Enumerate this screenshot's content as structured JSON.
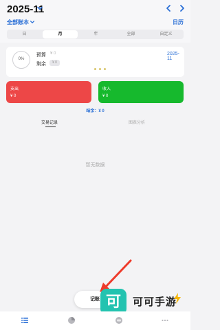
{
  "header": {
    "month": "2025-11",
    "all_books": "全部账本",
    "calendar": "日历"
  },
  "periods": [
    "日",
    "月",
    "年",
    "全部",
    "自定义"
  ],
  "selected_period": "月",
  "budget": {
    "progress": "0%",
    "budget_label": "预算",
    "budget_value": "¥ 0",
    "remaining_label": "剩余",
    "remaining_value": "¥ 0",
    "date": "2025-11"
  },
  "expense": {
    "label": "支出",
    "value": "¥ 0"
  },
  "income": {
    "label": "收入",
    "value": "¥ 0"
  },
  "balance": "结余：¥ 0",
  "tabs": {
    "records": "交易记录",
    "analysis": "图表分析"
  },
  "empty_text": "暂无数据",
  "fab_label": "记账",
  "watermark": {
    "logo_char": "可",
    "text": "可可手游"
  },
  "colors": {
    "accent": "#2a6fd6",
    "expense": "#ed4747",
    "income": "#16b92d",
    "watermark": "#23c3b0"
  },
  "bottom_nav": [
    "list-icon",
    "pie-chart-icon",
    "wallet-icon",
    "more-icon"
  ]
}
